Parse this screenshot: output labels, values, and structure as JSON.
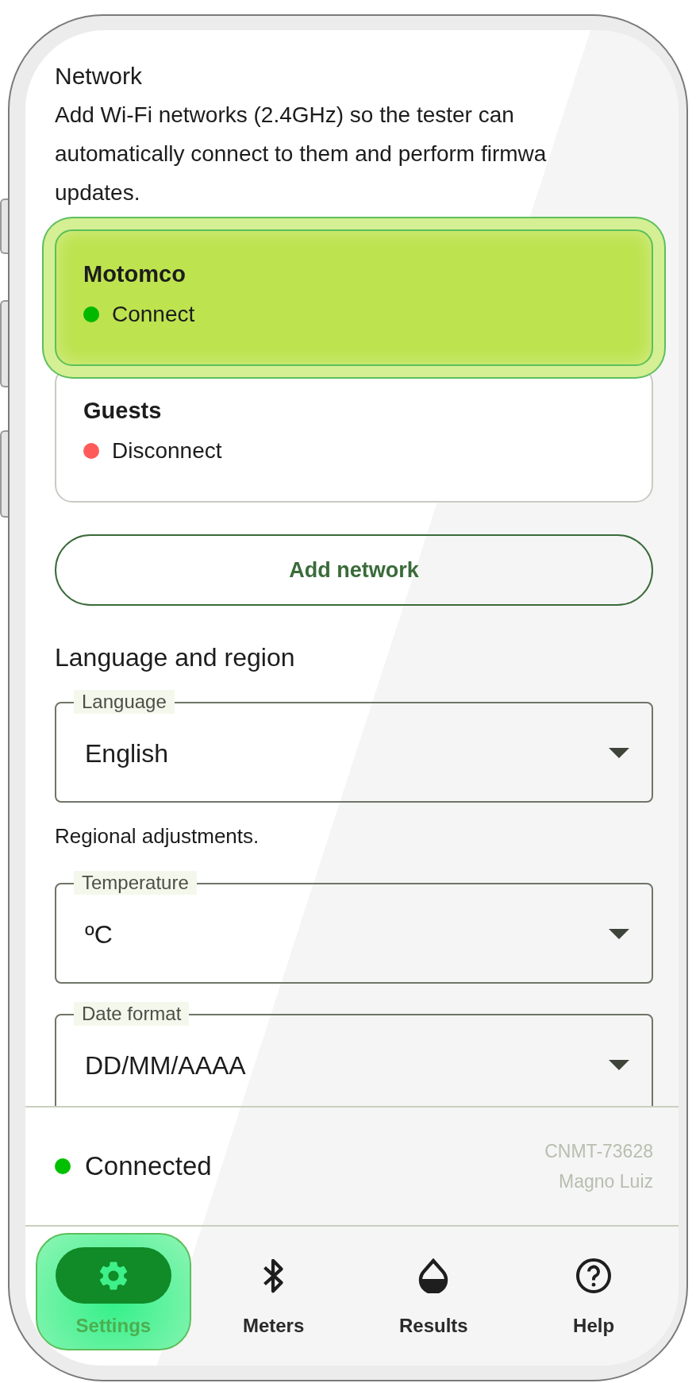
{
  "section": {
    "title": "Network",
    "description_lines": [
      "Add Wi-Fi networks (2.4GHz) so the tester can",
      "automatically connect to them and perform firmwa",
      "updates."
    ]
  },
  "networks": [
    {
      "name": "Motomco",
      "status": "Connect",
      "color": "#00b800",
      "selected": true
    },
    {
      "name": "Guests",
      "status": "Disconnect",
      "color": "#ff5a5a",
      "selected": false
    }
  ],
  "add_button": "Add network",
  "language_section": {
    "title": "Language and region",
    "fields": [
      {
        "label": "Language",
        "value": "English"
      }
    ]
  },
  "regional": {
    "note": "Regional adjustments.",
    "fields": [
      {
        "label": "Temperature",
        "value": "ºC"
      },
      {
        "label": "Date format",
        "value": "DD/MM/AAAA"
      }
    ]
  },
  "footer": {
    "status": "Connected",
    "device_id": "CNMT-73628",
    "user": "Magno Luiz"
  },
  "nav": [
    {
      "label": "Settings",
      "kind": "settings",
      "selected": true
    },
    {
      "label": "Meters",
      "kind": "bluetooth",
      "selected": false
    },
    {
      "label": "Results",
      "kind": "drop",
      "selected": false
    },
    {
      "label": "Help",
      "kind": "help",
      "selected": false
    }
  ]
}
